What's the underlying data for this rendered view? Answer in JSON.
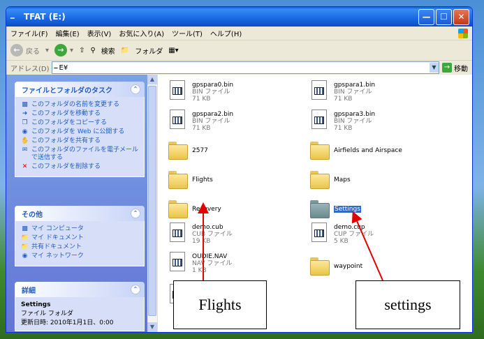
{
  "window": {
    "title": "TFAT (E:)"
  },
  "menu": [
    "ファイル(F)",
    "編集(E)",
    "表示(V)",
    "お気に入り(A)",
    "ツール(T)",
    "ヘルプ(H)"
  ],
  "toolbar": {
    "back": "戻る",
    "search": "検索",
    "folders": "フォルダ"
  },
  "address": {
    "label": "アドレス(D)",
    "value": "E¥",
    "go": "移動"
  },
  "tasks_panel": {
    "title": "ファイルとフォルダのタスク",
    "items": [
      "このフォルダの名前を変更する",
      "このフォルダを移動する",
      "このフォルダをコピーする",
      "このフォルダを Web に公開する",
      "このフォルダを共有する",
      "このフォルダのファイルを電子メールで送信する",
      "このフォルダを削除する"
    ]
  },
  "other_panel": {
    "title": "その他",
    "items": [
      "マイ コンピュータ",
      "マイ ドキュメント",
      "共有ドキュメント",
      "マイ ネットワーク"
    ]
  },
  "detail_panel": {
    "title": "詳細",
    "name": "Settings",
    "type": "ファイル フォルダ",
    "modified": "更新日時: 2010年1月1日、0:00"
  },
  "files": [
    {
      "name": "gpspara0.bin",
      "type": "BIN ファイル",
      "size": "71 KB"
    },
    {
      "name": "gpspara1.bin",
      "type": "BIN ファイル",
      "size": "71 KB"
    },
    {
      "name": "gpspara2.bin",
      "type": "BIN ファイル",
      "size": "71 KB"
    },
    {
      "name": "gpspara3.bin",
      "type": "BIN ファイル",
      "size": "71 KB"
    },
    {
      "name": "2577"
    },
    {
      "name": "Airfields and Airspace"
    },
    {
      "name": "Flights"
    },
    {
      "name": "Maps"
    },
    {
      "name": "Recovery"
    },
    {
      "name": "Settings"
    },
    {
      "name": "demo.cub",
      "type": "CUB ファイル",
      "size": "19 KB"
    },
    {
      "name": "demo.cup",
      "type": "CUP ファイル",
      "size": "5 KB"
    },
    {
      "name": "OUDIE.NAV",
      "type": "NAV ファイル",
      "size": "1 KB"
    },
    {
      "name": "waypoint"
    }
  ],
  "annotations": {
    "left": "Flights",
    "right": "settings"
  }
}
